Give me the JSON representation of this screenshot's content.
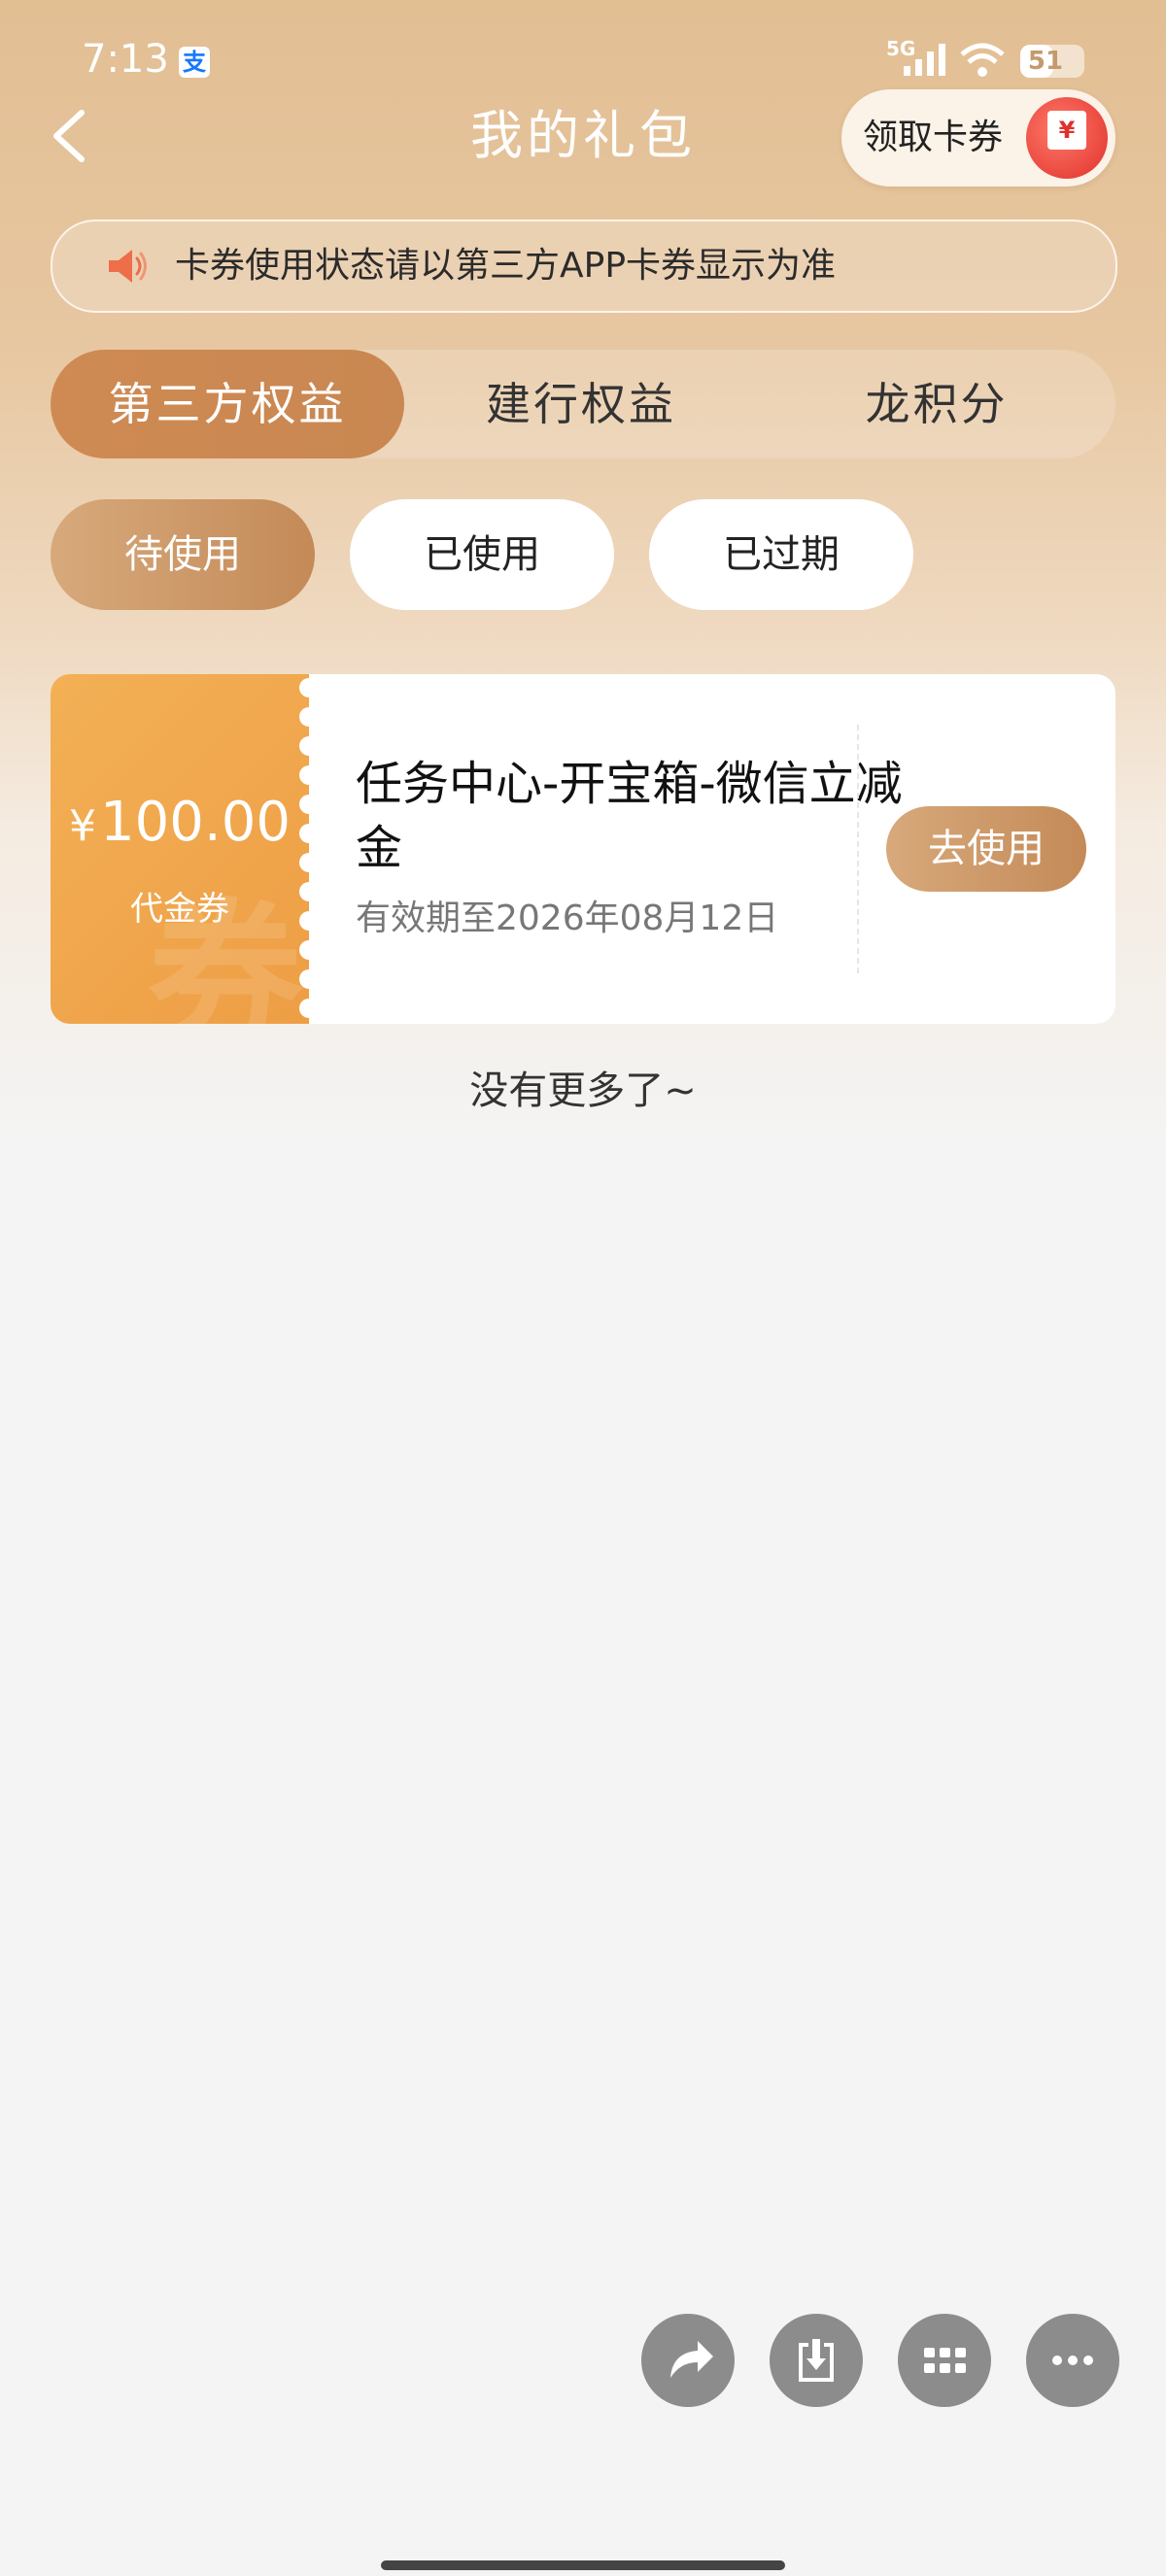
{
  "status_bar": {
    "time": "7:13",
    "app_icon": "alipay-icon",
    "network": "5G",
    "battery": "51",
    "battery_level": 0.51
  },
  "header": {
    "title": "我的礼包",
    "claim_label": "领取卡券",
    "claim_icon_symbol": "¥"
  },
  "notice": {
    "icon": "speaker-icon",
    "text": "卡券使用状态请以第三方APP卡券显示为准"
  },
  "main_tabs": [
    {
      "label": "第三方权益",
      "active": true
    },
    {
      "label": "建行权益",
      "active": false
    },
    {
      "label": "龙积分",
      "active": false
    }
  ],
  "status_tabs": [
    {
      "label": "待使用",
      "active": true
    },
    {
      "label": "已使用",
      "active": false
    },
    {
      "label": "已过期",
      "active": false
    }
  ],
  "coupons": [
    {
      "currency": "¥",
      "amount": "100.00",
      "type": "代金券",
      "watermark": "券",
      "title": "任务中心-开宝箱-微信立减金",
      "expiry": "有效期至2026年08月12日",
      "action": "去使用"
    }
  ],
  "footer_text": "没有更多了~",
  "floating_actions": [
    {
      "icon": "share-icon"
    },
    {
      "icon": "download-icon"
    },
    {
      "icon": "grid-icon"
    },
    {
      "icon": "more-icon"
    }
  ],
  "colors": {
    "accent": "#c98751",
    "coupon": "#f0a24a",
    "fab": "#8c8c8c"
  }
}
